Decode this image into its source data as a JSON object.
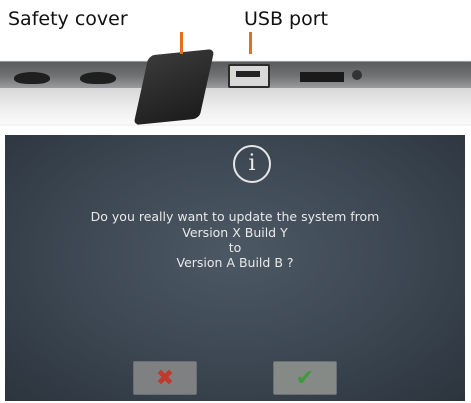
{
  "photo": {
    "labels": {
      "safety_cover": "Safety cover",
      "usb_port": "USB port"
    },
    "accent_color": "#e07020"
  },
  "dialog": {
    "icon": "info-icon",
    "icon_glyph": "i",
    "message_lines": [
      "Do you really want to update the system from",
      "Version X Build Y",
      "to",
      "Version A Build B ?"
    ],
    "buttons": {
      "cancel_glyph": "✖",
      "confirm_glyph": "✔"
    },
    "colors": {
      "cancel": "#c0392b",
      "confirm": "#3d9a3f"
    }
  }
}
